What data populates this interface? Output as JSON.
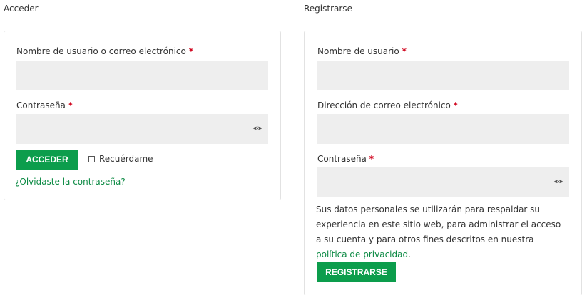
{
  "login": {
    "title": "Acceder",
    "username_label": "Nombre de usuario o correo electrónico",
    "password_label": "Contraseña",
    "required_mark": "*",
    "submit_label": "ACCEDER",
    "remember_label": "Recuérdame",
    "forgot_link": "¿Olvidaste la contraseña?"
  },
  "register": {
    "title": "Registrarse",
    "username_label": "Nombre de usuario",
    "email_label": "Dirección de correo electrónico",
    "password_label": "Contraseña",
    "required_mark": "*",
    "privacy_text": "Sus datos personales se utilizarán para respaldar su experiencia en este sitio web, para administrar el acceso a su cuenta y para otros fines descritos en nuestra ",
    "privacy_link": "política de privacidad",
    "privacy_end": ".",
    "submit_label": "REGISTRARSE"
  },
  "colors": {
    "accent": "#0c9d4c",
    "link": "#0c8a44",
    "required": "#d0021b",
    "input_bg": "#eeeeee"
  }
}
